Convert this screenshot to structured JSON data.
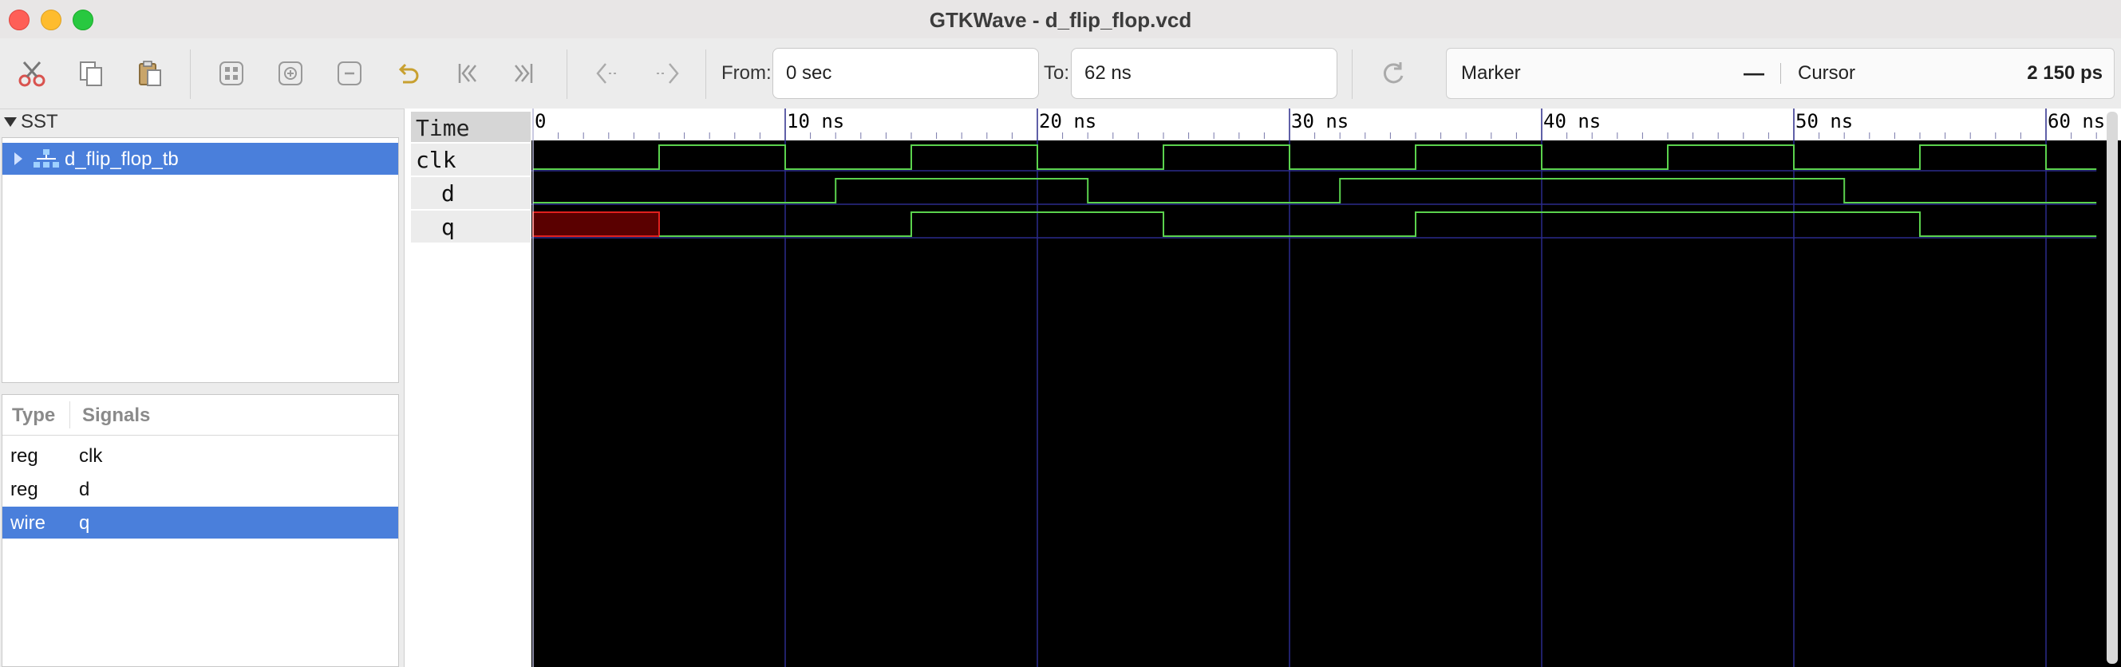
{
  "window": {
    "title": "GTKWave - d_flip_flop.vcd"
  },
  "toolbar": {
    "buttons": [
      {
        "name": "cut-icon"
      },
      {
        "name": "copy-icon"
      },
      {
        "name": "paste-icon"
      },
      {
        "name": "zoom-fit-icon"
      },
      {
        "name": "zoom-in-icon"
      },
      {
        "name": "zoom-out-icon"
      },
      {
        "name": "undo-zoom-icon"
      },
      {
        "name": "jump-start-icon"
      },
      {
        "name": "jump-end-icon"
      },
      {
        "name": "prev-edge-icon"
      },
      {
        "name": "next-edge-icon"
      }
    ],
    "from_label": "From:",
    "from_value": "0 sec",
    "to_label": "To:",
    "to_value": "62 ns",
    "reload_icon": "reload-icon",
    "marker_label": "Marker",
    "marker_value": "—",
    "cursor_label": "Cursor",
    "cursor_value": "2 150 ps"
  },
  "sst": {
    "header": "SST",
    "tree": [
      {
        "label": "d_flip_flop_tb",
        "selected": true
      }
    ]
  },
  "signals_panel": {
    "col_type": "Type",
    "col_signals": "Signals",
    "rows": [
      {
        "type": "reg",
        "name": "clk",
        "selected": false
      },
      {
        "type": "reg",
        "name": "d",
        "selected": false
      },
      {
        "type": "wire",
        "name": "q",
        "selected": true
      }
    ]
  },
  "wave_names": {
    "time_label": "Time",
    "signals": [
      "clk",
      "d",
      "q"
    ]
  },
  "timeline": {
    "tick_labels": [
      "0",
      "10 ns",
      "20 ns",
      "30 ns",
      "40 ns",
      "50 ns",
      "60 ns"
    ],
    "major_ticks_ns": [
      0,
      10,
      20,
      30,
      40,
      50,
      60
    ]
  },
  "waveforms": {
    "clk": [
      [
        0,
        0
      ],
      [
        5,
        1
      ],
      [
        10,
        0
      ],
      [
        15,
        1
      ],
      [
        20,
        0
      ],
      [
        25,
        1
      ],
      [
        30,
        0
      ],
      [
        35,
        1
      ],
      [
        40,
        0
      ],
      [
        45,
        1
      ],
      [
        50,
        0
      ],
      [
        55,
        1
      ],
      [
        60,
        0
      ]
    ],
    "d": [
      [
        0,
        0
      ],
      [
        12,
        1
      ],
      [
        22,
        0
      ],
      [
        32,
        1
      ],
      [
        52,
        0
      ]
    ],
    "q_unknown_until_ns": 5,
    "q": [
      [
        5,
        0
      ],
      [
        15,
        1
      ],
      [
        25,
        0
      ],
      [
        35,
        1
      ],
      [
        55,
        0
      ]
    ]
  },
  "colors": {
    "wave": "#5bd24d",
    "unknown": "#e0201e",
    "grid": "#2b2b8c",
    "selection": "#4a7fdb"
  }
}
